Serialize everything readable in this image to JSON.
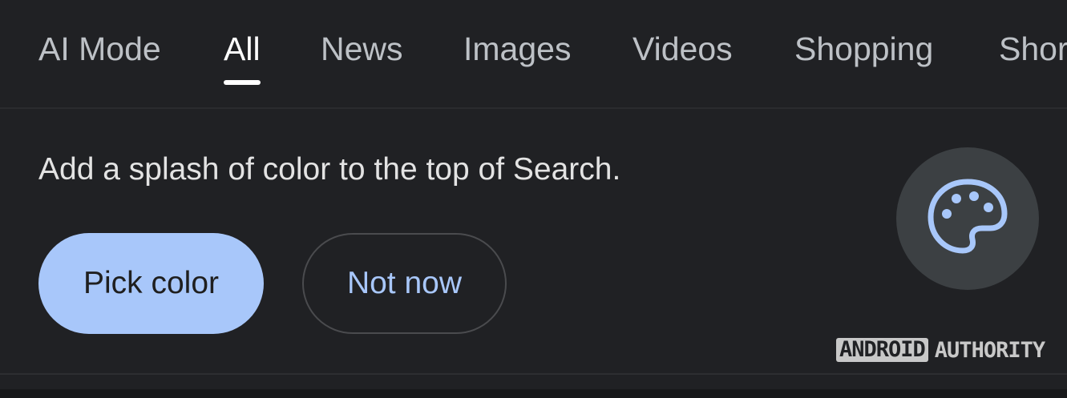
{
  "tabs": [
    {
      "label": "AI Mode"
    },
    {
      "label": "All",
      "active": true
    },
    {
      "label": "News"
    },
    {
      "label": "Images"
    },
    {
      "label": "Videos"
    },
    {
      "label": "Shopping"
    },
    {
      "label": "Shor"
    }
  ],
  "promo": {
    "text": "Add a splash of color to the top of Search.",
    "primary_button": "Pick color",
    "secondary_button": "Not now",
    "icon": "palette-icon"
  },
  "watermark": {
    "box_text": "ANDROID",
    "text": "AUTHORITY"
  },
  "colors": {
    "background": "#202124",
    "accent": "#a8c7fa",
    "icon_circle": "#3c4043"
  }
}
